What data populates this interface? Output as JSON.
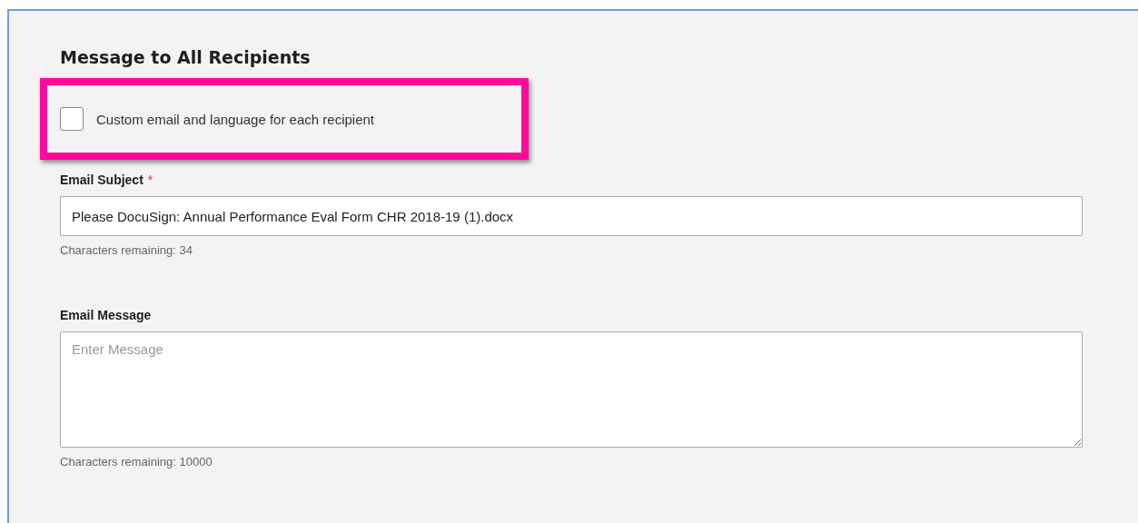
{
  "section": {
    "title": "Message to All Recipients"
  },
  "custom_option": {
    "label": "Custom email and language for each recipient",
    "checked": false,
    "highlighted": true
  },
  "email_subject": {
    "label": "Email Subject",
    "required": true,
    "required_mark": "*",
    "value": "Please DocuSign: Annual Performance Eval Form CHR 2018-19 (1).docx",
    "hint": "Characters remaining: 34"
  },
  "email_message": {
    "label": "Email Message",
    "placeholder": "Enter Message",
    "hint": "Characters remaining: 10000"
  }
}
